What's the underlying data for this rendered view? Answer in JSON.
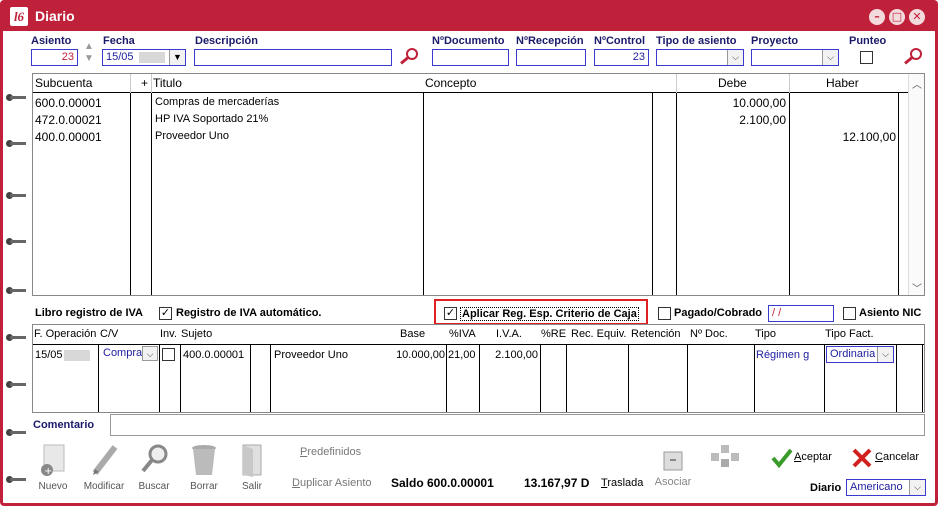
{
  "window": {
    "title": "Diario",
    "logo": "l6"
  },
  "header": {
    "asiento_label": "Asiento",
    "asiento_value": "23",
    "fecha_label": "Fecha",
    "fecha_value": "15/05",
    "descripcion_label": "Descripción",
    "descripcion_value": "",
    "ndocumento_label": "NºDocumento",
    "ndocumento_value": "",
    "nrecepcion_label": "NºRecepción",
    "nrecepcion_value": "",
    "ncontrol_label": "NºControl",
    "ncontrol_value": "23",
    "tipo_asiento_label": "Tipo de asiento",
    "tipo_asiento_value": "",
    "proyecto_label": "Proyecto",
    "proyecto_value": "",
    "punteo_label": "Punteo"
  },
  "entries_table": {
    "columns": {
      "subcuenta": "Subcuenta",
      "plus": "+",
      "titulo": "Titulo",
      "concepto": "Concepto",
      "debe": "Debe",
      "haber": "Haber"
    },
    "rows": [
      {
        "subcuenta": "600.0.00001",
        "titulo": "Compras de mercaderías",
        "concepto": "",
        "debe": "10.000,00",
        "haber": ""
      },
      {
        "subcuenta": "472.0.00021",
        "titulo": "HP IVA Soportado 21%",
        "concepto": "",
        "debe": "2.100,00",
        "haber": ""
      },
      {
        "subcuenta": "400.0.00001",
        "titulo": "Proveedor Uno",
        "concepto": "",
        "debe": "",
        "haber": "12.100,00"
      }
    ]
  },
  "iva_bar": {
    "libro_label": "Libro registro de IVA",
    "registro_auto_label": "Registro de IVA automático.",
    "registro_auto_checked": true,
    "criterio_caja_label": "Aplicar Reg. Esp. Criterio de Caja",
    "criterio_caja_checked": true,
    "pagado_label": "Pagado/Cobrado",
    "pagado_value": " / /",
    "asiento_nic_label": "Asiento NIC"
  },
  "iva_table": {
    "columns": {
      "f_operacion": "F. Operación",
      "cv": "C/V",
      "inv": "Inv.",
      "sujeto": "Sujeto",
      "base": "Base",
      "piva": "%IVA",
      "iva": "I.V.A.",
      "pre": "%RE",
      "rec_equiv": "Rec. Equiv.",
      "retencion": "Retención",
      "ndoc": "Nº Doc.",
      "tipo": "Tipo",
      "tipo_fact": "Tipo Fact."
    },
    "row": {
      "f_operacion": "15/05",
      "cv": "Compra",
      "sujeto": "400.0.00001",
      "nombre": "Proveedor Uno",
      "base": "10.000,00",
      "piva": "21,00",
      "iva": "2.100,00",
      "tipo": "Régimen g",
      "tipo_fact": "Ordinaria"
    }
  },
  "comentario_label": "Comentario",
  "toolbar": {
    "nuevo": "Nuevo",
    "modificar": "Modificar",
    "buscar": "Buscar",
    "borrar": "Borrar",
    "salir": "Salir",
    "predefinidos": "Predefinidos",
    "duplicar": "Duplicar Asiento",
    "saldo_label": "Saldo 600.0.00001",
    "saldo_value": "13.167,97 D",
    "traslada": "Traslada",
    "asociar": "Asociar",
    "aceptar": "Aceptar",
    "cancelar": "Cancelar",
    "diario_label": "Diario",
    "diario_value": "Americano"
  },
  "colors": {
    "accent": "#c0213a",
    "label_blue": "#1a1a6a",
    "field_border": "#3a3ad0",
    "highlight_box": "#e02020",
    "ok_green": "#3a9a2a"
  }
}
